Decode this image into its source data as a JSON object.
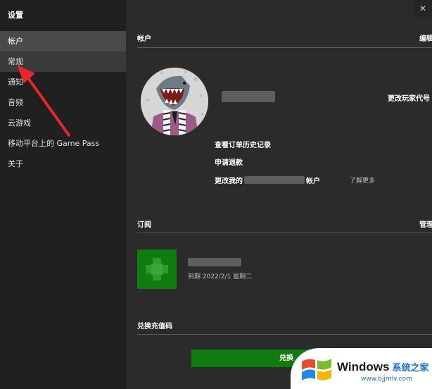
{
  "sidebar": {
    "title": "设置",
    "items": [
      {
        "label": "帐户"
      },
      {
        "label": "常规"
      },
      {
        "label": "通知"
      },
      {
        "label": "音频"
      },
      {
        "label": "云游戏"
      },
      {
        "label": "移动平台上的 Game Pass"
      },
      {
        "label": "关于"
      }
    ]
  },
  "window": {
    "close_label": "✕"
  },
  "account": {
    "title": "帐户",
    "action_label": "编辑",
    "change_gamertag": "更改玩家代号",
    "links": {
      "order_history": "查看订单历史记录",
      "refund": "申请退款",
      "change_prefix": "更改我的",
      "change_suffix": "帐户",
      "learn_more": "了解更多"
    }
  },
  "subscription": {
    "title": "订阅",
    "action_label": "管理",
    "expiry": "到期 2022/2/1 星期二"
  },
  "redeem": {
    "title": "兑换充值码",
    "button_label": "兑换"
  },
  "watermark": {
    "brand": "Windows",
    "brand_cn": "系统之家",
    "url": "www.bjjmlv.com"
  },
  "colors": {
    "sidebar_bg": "#202020",
    "main_bg": "#2b2b2b",
    "active_item": "#4a4a4a",
    "xbox_green": "#107c10",
    "annotation_red": "#e8262a"
  }
}
